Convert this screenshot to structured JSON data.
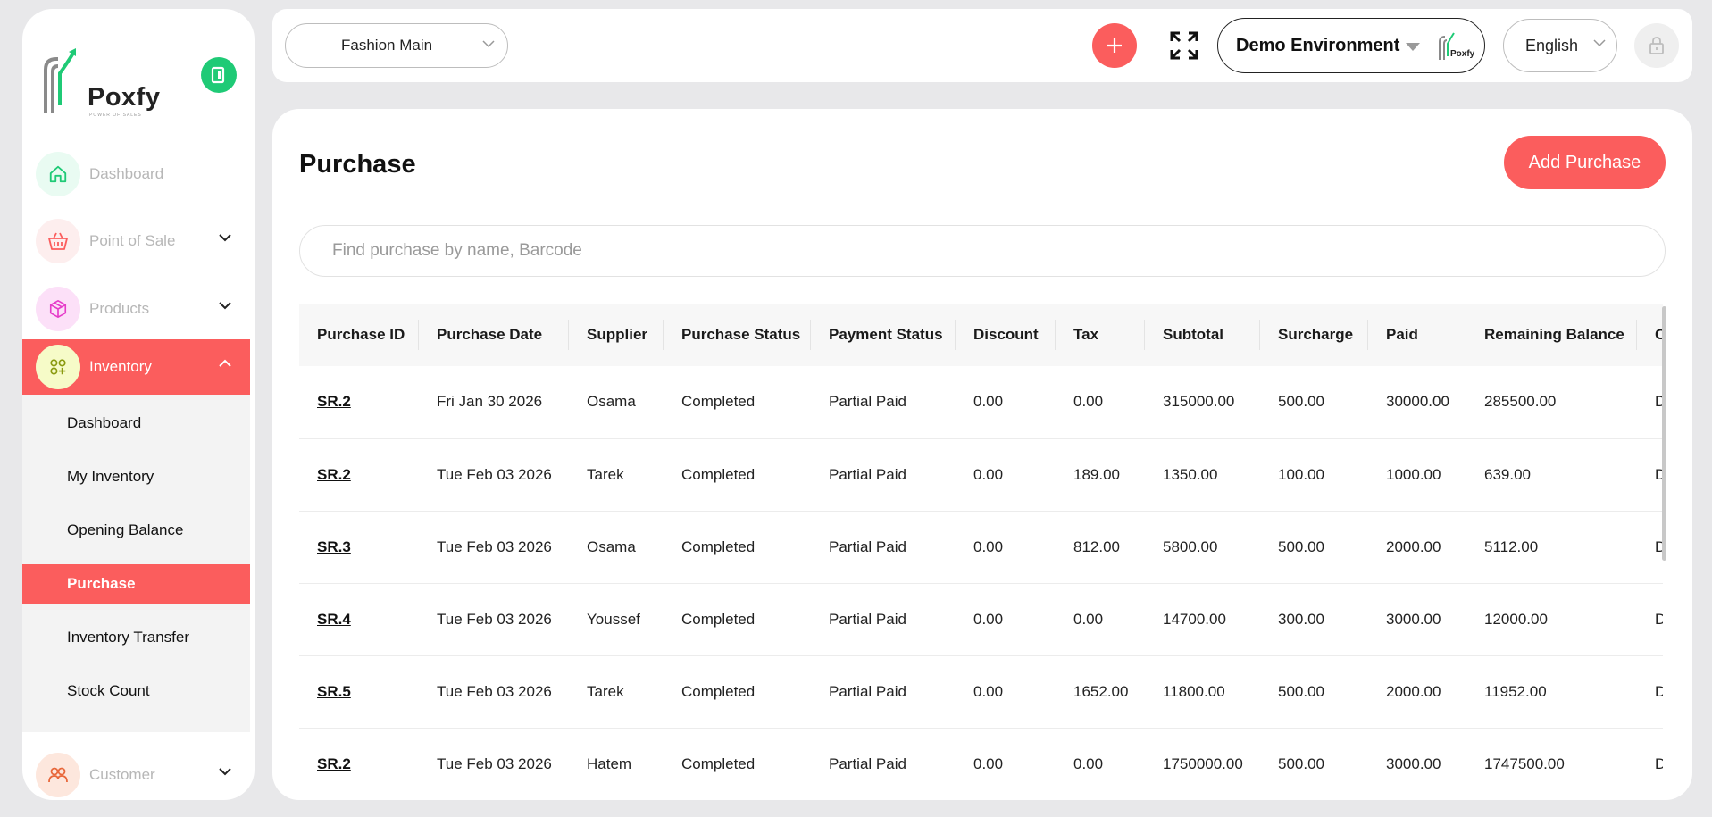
{
  "brand": {
    "name": "Poxfy",
    "tagline": "POWER OF SALES",
    "accent": "#fb5d5d",
    "green": "#1fca76"
  },
  "sidebar": {
    "items": [
      {
        "label": "Dashboard",
        "icon": "home-icon",
        "expandable": false
      },
      {
        "label": "Point of Sale",
        "icon": "basket-icon",
        "expandable": true
      },
      {
        "label": "Products",
        "icon": "box-icon",
        "expandable": true
      },
      {
        "label": "Inventory",
        "icon": "inventory-icon",
        "expandable": true,
        "expanded": true
      },
      {
        "label": "Customer",
        "icon": "users-icon",
        "expandable": true
      }
    ],
    "submenu": [
      "Dashboard",
      "My Inventory",
      "Opening Balance",
      "Purchase",
      "Inventory Transfer",
      "Stock Count"
    ],
    "active_sub": "Purchase"
  },
  "topbar": {
    "branch": "Fashion Main",
    "environment": "Demo Environment",
    "env_logo": "Poxfy",
    "language": "English"
  },
  "page": {
    "title": "Purchase",
    "add_button": "Add Purchase",
    "search_placeholder": "Find purchase by name, Barcode"
  },
  "table": {
    "columns": [
      "Purchase ID",
      "Purchase Date",
      "Supplier",
      "Purchase Status",
      "Payment Status",
      "Discount",
      "Tax",
      "Subtotal",
      "Surcharge",
      "Paid",
      "Remaining Balance",
      "C"
    ],
    "rows": [
      [
        "SR.2",
        "Fri Jan 30 2026",
        "Osama",
        "Completed",
        "Partial Paid",
        "0.00",
        "0.00",
        "315000.00",
        "500.00",
        "30000.00",
        "285500.00",
        "D"
      ],
      [
        "SR.2",
        "Tue Feb 03 2026",
        "Tarek",
        "Completed",
        "Partial Paid",
        "0.00",
        "189.00",
        "1350.00",
        "100.00",
        "1000.00",
        "639.00",
        "D"
      ],
      [
        "SR.3",
        "Tue Feb 03 2026",
        "Osama",
        "Completed",
        "Partial Paid",
        "0.00",
        "812.00",
        "5800.00",
        "500.00",
        "2000.00",
        "5112.00",
        "D"
      ],
      [
        "SR.4",
        "Tue Feb 03 2026",
        "Youssef",
        "Completed",
        "Partial Paid",
        "0.00",
        "0.00",
        "14700.00",
        "300.00",
        "3000.00",
        "12000.00",
        "D"
      ],
      [
        "SR.5",
        "Tue Feb 03 2026",
        "Tarek",
        "Completed",
        "Partial Paid",
        "0.00",
        "1652.00",
        "11800.00",
        "500.00",
        "2000.00",
        "11952.00",
        "D"
      ],
      [
        "SR.2",
        "Tue Feb 03 2026",
        "Hatem",
        "Completed",
        "Partial Paid",
        "0.00",
        "0.00",
        "1750000.00",
        "500.00",
        "3000.00",
        "1747500.00",
        "D"
      ]
    ]
  }
}
